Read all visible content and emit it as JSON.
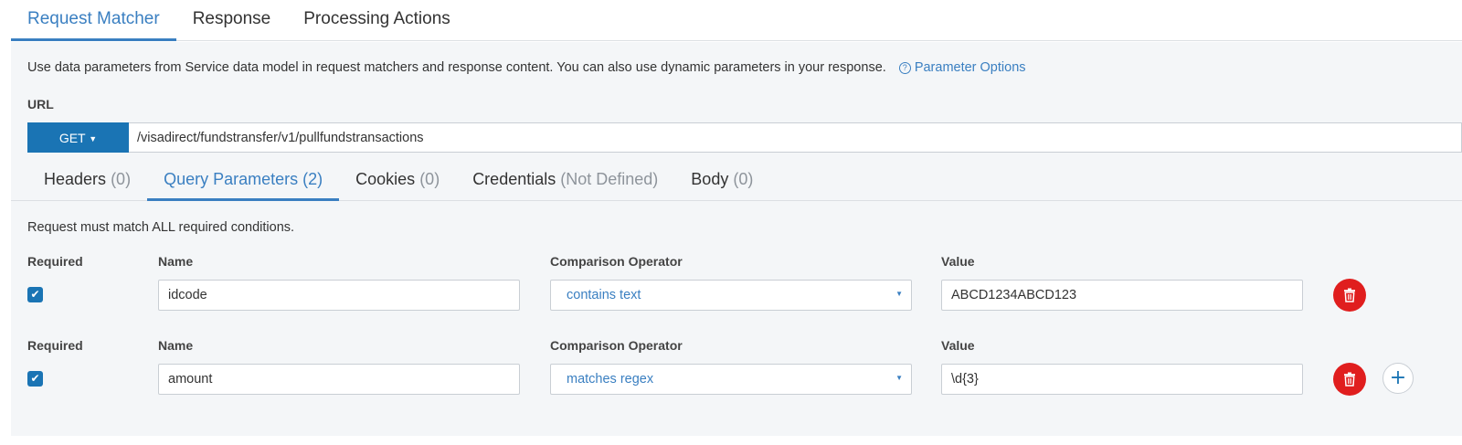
{
  "top_tabs": [
    {
      "label": "Request Matcher",
      "active": true
    },
    {
      "label": "Response",
      "active": false
    },
    {
      "label": "Processing Actions",
      "active": false
    }
  ],
  "info": {
    "text": "Use data parameters from Service data model in request matchers and response content. You can also use dynamic parameters in your response.",
    "link_label": "Parameter Options"
  },
  "url": {
    "label": "URL",
    "method": "GET",
    "path": "/visadirect/fundstransfer/v1/pullfundstransactions"
  },
  "sub_tabs": [
    {
      "label": "Headers",
      "count": "(0)"
    },
    {
      "label": "Query Parameters",
      "count": "(2)"
    },
    {
      "label": "Cookies",
      "count": "(0)"
    },
    {
      "label": "Credentials",
      "count": "(Not Defined)"
    },
    {
      "label": "Body",
      "count": "(0)"
    }
  ],
  "match_note": "Request must match ALL required conditions.",
  "column_labels": {
    "required": "Required",
    "name": "Name",
    "operator": "Comparison Operator",
    "value": "Value"
  },
  "params": [
    {
      "required": true,
      "name": "idcode",
      "operator": "contains text",
      "value": "ABCD1234ABCD123"
    },
    {
      "required": true,
      "name": "amount",
      "operator": "matches regex",
      "value": "\\d{3}"
    }
  ],
  "colors": {
    "accent": "#3a7fc1",
    "primary_button": "#1a74b4",
    "delete": "#e01e1e",
    "panel_bg": "#f4f6f8"
  },
  "icons": {
    "info": "question-circle-icon",
    "checkbox": "check-icon",
    "delete": "trash-icon",
    "add": "plus-icon"
  }
}
